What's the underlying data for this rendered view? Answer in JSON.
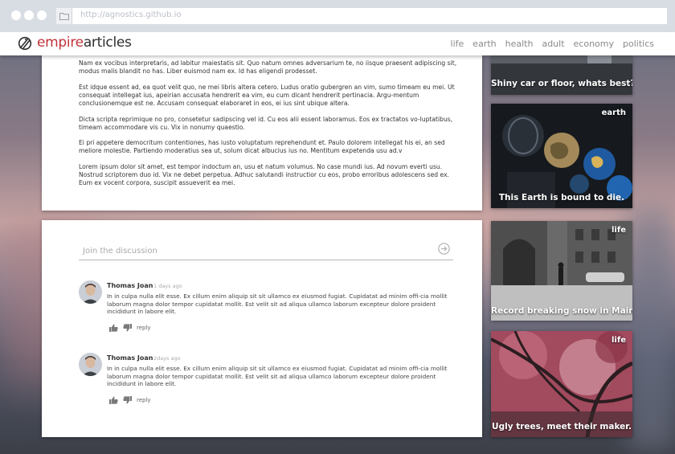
{
  "browser": {
    "url": "http://agnostics.github.io"
  },
  "nav": {
    "brand_part1": "empire",
    "brand_part2": "articles",
    "links": [
      "life",
      "earth",
      "health",
      "adult",
      "economy",
      "politics"
    ]
  },
  "article": {
    "paragraphs": [
      "Nam ex vocibus interpretaris, ad labitur maiestatis sit. Quo natum omnes adversarium te, no iisque praesent adipiscing sit, modus malis blandit no has. Liber euismod nam ex. Id has eligendi prodesset.",
      "Est idque essent ad, ea quot velit quo, ne mei libris altera cetero. Ludus oratio gubergren an vim, sumo timeam eu mei. Ut consequat intellegat ius, apeirian accusata hendrerit ea vim, eu cum dicant hendrerit pertinacia. Argu-mentum conclusionemque est ne. Accusam consequat elaboraret in eos, ei ius sint ubique altera.",
      "Dicta scripta reprimique no pro, consetetur sadipscing vel id. Cu eos alii essent laboramus. Eos ex tractatos vo-luptatibus, timeam accommodare vis cu. Vix in nonumy quaestio.",
      "Ei pri appetere democritum contentiones, has iusto voluptatum reprehendunt et. Paulo dolorem intellegat his ei, an sed meliore molestie. Partiendo moderatius sea ut, solum dicat albucius ius no. Mentitum expetenda usu ad.v",
      "Lorem ipsum dolor sit amet, est tempor indoctum an, usu et natum volumus. No case mundi ius. Ad novum everti usu. Nostrud scriptorem duo id. Vix ne debet perpetua. Adhuc salutandi instructior cu eos, probo erroribus adolescens sed ex. Eum ex vocent corpora, suscipit assueverit ea mei."
    ]
  },
  "discussion": {
    "placeholder": "Join the discussion",
    "comments": [
      {
        "author": "Thomas Joan",
        "time": "1 days ago",
        "text": "In in culpa nulla elit esse. Ex cillum enim aliquip sit sit ullamco ex eiusmod fugiat. Cupidatat ad minim offi-cia mollit laborum magna dolor tempor cupidatat mollit. Est velit sit ad aliqua ullamco laborum excepteur dolore proident incididunt in labore elit.",
        "reply_label": "reply"
      },
      {
        "author": "Thomas Joan",
        "time": "2days ago",
        "text": "In in culpa nulla elit esse. Ex cillum enim aliquip sit sit ullamco ex eiusmod fugiat. Cupidatat ad minim offi-cia mollit laborum magna dolor tempor cupidatat mollit. Est velit sit ad aliqua ullamco laborum excepteur dolore proident incididunt in labore elit.",
        "reply_label": "reply"
      }
    ]
  },
  "sidebar": [
    {
      "tag": "",
      "caption": "Shiny car or floor, whats best?"
    },
    {
      "tag": "earth",
      "caption": "This Earth is bound to die."
    },
    {
      "tag": "life",
      "caption": "Record breaking snow in Maine"
    },
    {
      "tag": "life",
      "caption": "Ugly trees, meet their maker."
    }
  ],
  "colors": {
    "brand_accent": "#c0333b",
    "nav_link": "#8a8a8a"
  }
}
